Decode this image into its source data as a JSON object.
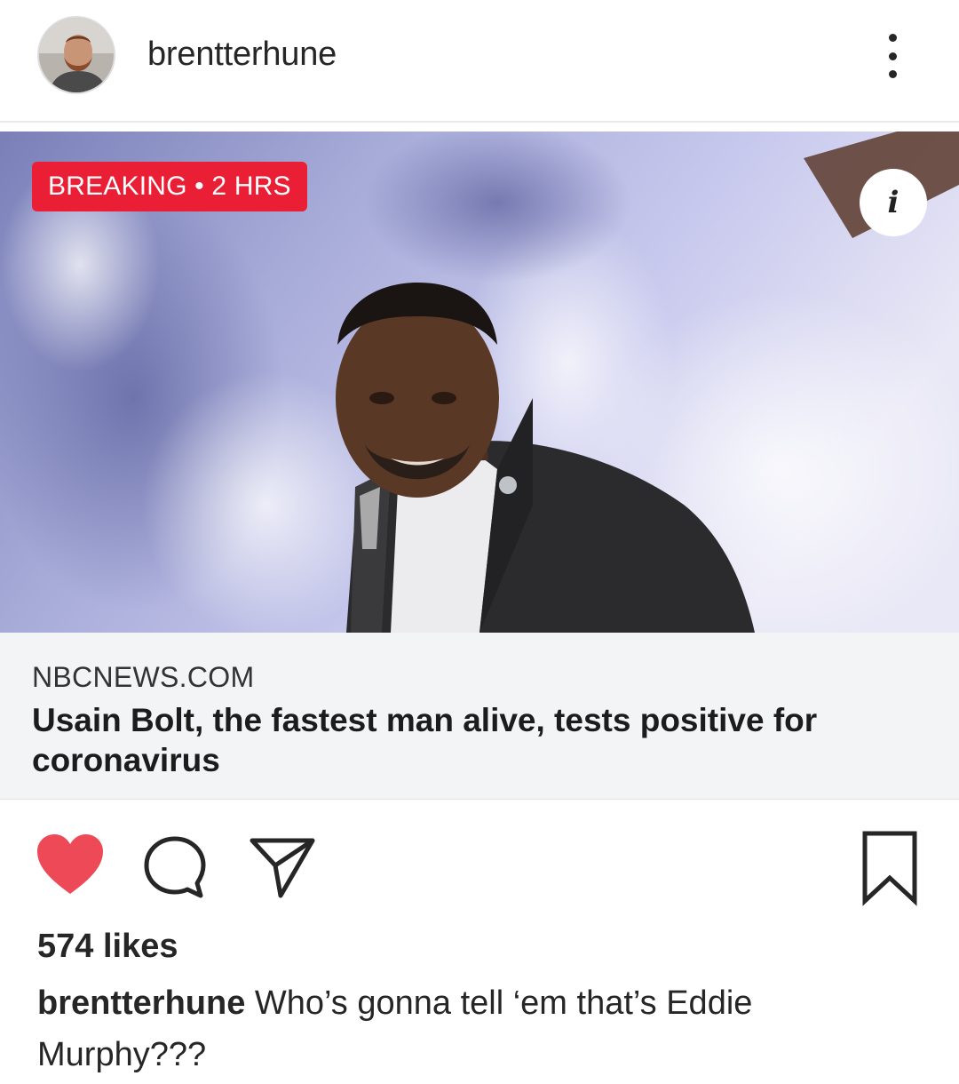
{
  "post": {
    "username": "brentterhune",
    "more_icon": "more-vertical-icon"
  },
  "link_preview": {
    "badge": "BREAKING • 2 HRS",
    "source": "NBCNEWS.COM",
    "headline": "Usain Bolt, the fastest man alive, tests positive for coronavirus",
    "info_label": "i",
    "badge_color": "#ea1f35"
  },
  "actions": {
    "like_icon": "heart-icon",
    "like_color": "#ed4956",
    "comment_icon": "comment-icon",
    "share_icon": "paper-plane-icon",
    "save_icon": "bookmark-icon"
  },
  "likes": "574 likes",
  "caption": {
    "username": "brentterhune",
    "text": "Who’s gonna tell ‘em that’s Eddie Murphy???"
  }
}
